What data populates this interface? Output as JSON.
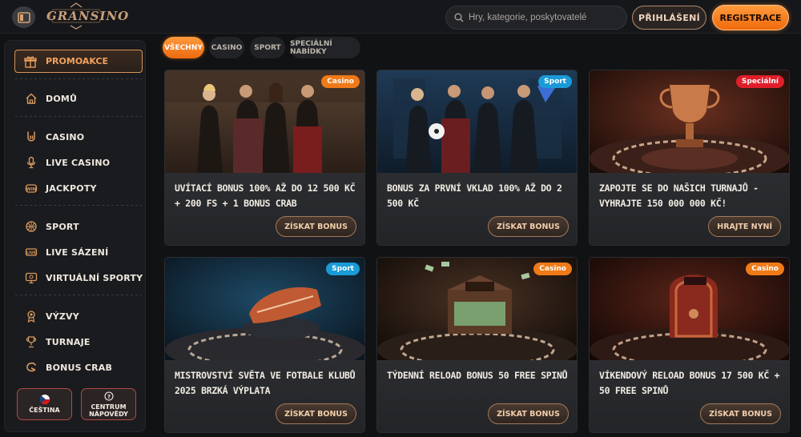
{
  "header": {
    "logo_text": "GRANSINO",
    "search_placeholder": "Hry, kategorie, poskytovatelé",
    "login_label": "PŘIHLÁŠENÍ",
    "register_label": "REGISTRACE"
  },
  "sidebar": {
    "promo_label": "PROMOAKCE",
    "items": [
      {
        "label": "DOMŮ",
        "icon": "home-icon"
      },
      {
        "label": "CASINO",
        "icon": "rock-hand-icon"
      },
      {
        "label": "LIVE CASINO",
        "icon": "microphone-icon"
      },
      {
        "label": "JACKPOTY",
        "icon": "jackpot-icon"
      },
      {
        "label": "SPORT",
        "icon": "basketball-icon"
      },
      {
        "label": "LIVE SÁZENÍ",
        "icon": "live-icon"
      },
      {
        "label": "VIRTUÁLNÍ SPORTY",
        "icon": "monitor-icon"
      },
      {
        "label": "VÝZVY",
        "icon": "medal-icon"
      },
      {
        "label": "TURNAJE",
        "icon": "trophy-icon"
      },
      {
        "label": "BONUS CRAB",
        "icon": "crab-icon"
      }
    ],
    "language_label": "ČEŠTINA",
    "help_label": "CENTRUM NÁPOVĚDY"
  },
  "tabs": [
    "VŠECHNY",
    "CASINO",
    "SPORT",
    "SPECIÁLNÍ NABÍDKY"
  ],
  "cards": [
    {
      "badge": "Casino",
      "badge_color": "#f07a18",
      "title": "UVÍTACÍ BONUS 100% AŽ DO 12 500 KČ + 200 FS + 1 BONUS CRAB",
      "button": "ZÍSKAT BONUS"
    },
    {
      "badge": "Sport",
      "badge_color": "#1a9ad6",
      "title": "BONUS ZA PRVNÍ VKLAD 100% AŽ DO 2 500 KČ",
      "button": "ZÍSKAT BONUS"
    },
    {
      "badge": "Speciální",
      "badge_color": "#e01e2a",
      "title": "ZAPOJTE SE DO NAŠICH TURNAJŮ - VYHRAJTE 150 000 000 KČ!",
      "button": "HRAJTE NYNÍ"
    },
    {
      "badge": "Sport",
      "badge_color": "#1a9ad6",
      "title": "MISTROVSTVÍ SVĚTA VE FOTBALE KLUBŮ 2025 BRZKÁ VÝPLATA",
      "button": "ZÍSKAT BONUS"
    },
    {
      "badge": "Casino",
      "badge_color": "#f07a18",
      "title": "TÝDENNÍ RELOAD BONUS 50 FREE SPINŮ",
      "button": "ZÍSKAT BONUS"
    },
    {
      "badge": "Casino",
      "badge_color": "#f07a18",
      "title": "VÍKENDOVÝ RELOAD BONUS 17 500 KČ + 50 FREE SPINŮ",
      "button": "ZÍSKAT BONUS"
    }
  ],
  "colors": {
    "accent": "#f07a18",
    "sport": "#1a9ad6",
    "special": "#e01e2a"
  }
}
